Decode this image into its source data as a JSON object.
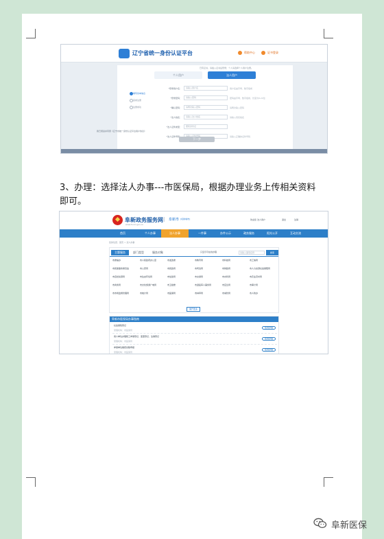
{
  "screenshot1": {
    "title": "辽宁省统一身份认证平台",
    "header_buttons": [
      "帮助中心",
      "证书登录"
    ],
    "top_note": "已有证书，请插入证书后登录；个人请选择个人用户注册。",
    "tabs": [
      "个人用户",
      "法人用户"
    ],
    "steps": [
      "填写基本信息",
      "完成注册",
      "注册成功"
    ],
    "fields": [
      {
        "label": "*登录用户名：",
        "placeholder": "请输入用户名",
        "hint": "用户名由字母、数字组成"
      },
      {
        "label": "*登录密码：",
        "placeholder": "请输入密码",
        "hint": "密码由字母、数字组成，长度为8-20位"
      },
      {
        "label": "*确认密码：",
        "placeholder": "请再次输入密码",
        "hint": "请再次输入密码"
      },
      {
        "label": "*法人姓名：",
        "placeholder": "请输入法人姓名",
        "hint": "请输入真实姓名"
      },
      {
        "label": "*法人证件类型：",
        "placeholder": "居民身份证",
        "hint": ""
      },
      {
        "label": "*法人证件号码：",
        "placeholder": "请输入证件号码",
        "hint": "请输入正确的证件号码"
      }
    ],
    "agree_text": "我已阅读并同意《辽宁省统一身份认证平台用户协议》",
    "submit_label": "下一步"
  },
  "instruction": "3、办理：选择法人办事---市医保局，根据办理业务上传相关资料即可。",
  "screenshot2": {
    "brand": "阜新政务服务网",
    "brand_sub": "www.fuxin.gov.cn",
    "city": "阜新市",
    "switch_label": "[切换城市]",
    "user_items": [
      "欢迎您 法人用户",
      "退出",
      "注销"
    ],
    "nav": [
      "首页",
      "个人办事",
      "法人办事",
      "一件事",
      "办件公示",
      "政务服务",
      "阳光公开",
      "互动交流"
    ],
    "breadcrumb": "您的位置：首页 > 法人办事",
    "filter_tabs": [
      "主题服务",
      "部门类型",
      "服务对象"
    ],
    "filter_check": "只显示可在线办理",
    "search_placeholder": "请输入事项名称",
    "search_label": "搜索",
    "grid": [
      [
        "市委编办",
        "市人民政府办公室",
        "市发改委",
        "市教育局",
        "市科技局",
        "市工信局"
      ],
      [
        "市民族事务委员会",
        "市公安局",
        "市民政局",
        "市司法局",
        "市财政局",
        "市人力资源社会保障局"
      ],
      [
        "市自然资源局",
        "市生态环境局",
        "市住建局",
        "市交通局",
        "市水利局",
        "市农业农村局"
      ],
      [
        "市商务局",
        "市文化旅游广电局",
        "市卫健委",
        "市退役军人事务局",
        "市应急局",
        "市审计局"
      ],
      [
        "市市场监督管理局",
        "市统计局",
        "市医保局",
        "市林草局",
        "市城管局",
        "市人防办"
      ]
    ],
    "more_label": "展开更多",
    "list_title": "阜新市医保局办事指南",
    "items": [
      {
        "title": "社会保险登记",
        "meta": "受理机构：市医保局",
        "button": "在线办理"
      },
      {
        "title": "用人单位办理职工参保登记、变更登记、注销登记",
        "meta": "受理机构：市医保局",
        "button": "在线办理"
      },
      {
        "title": "参保单位缴费基数申报",
        "meta": "受理机构：市医保局",
        "button": "在线办理"
      },
      {
        "title": "单位参保信息查询",
        "meta": "受理机构：市医保局",
        "button": "在线办理"
      }
    ]
  },
  "watermark": "阜新医保"
}
